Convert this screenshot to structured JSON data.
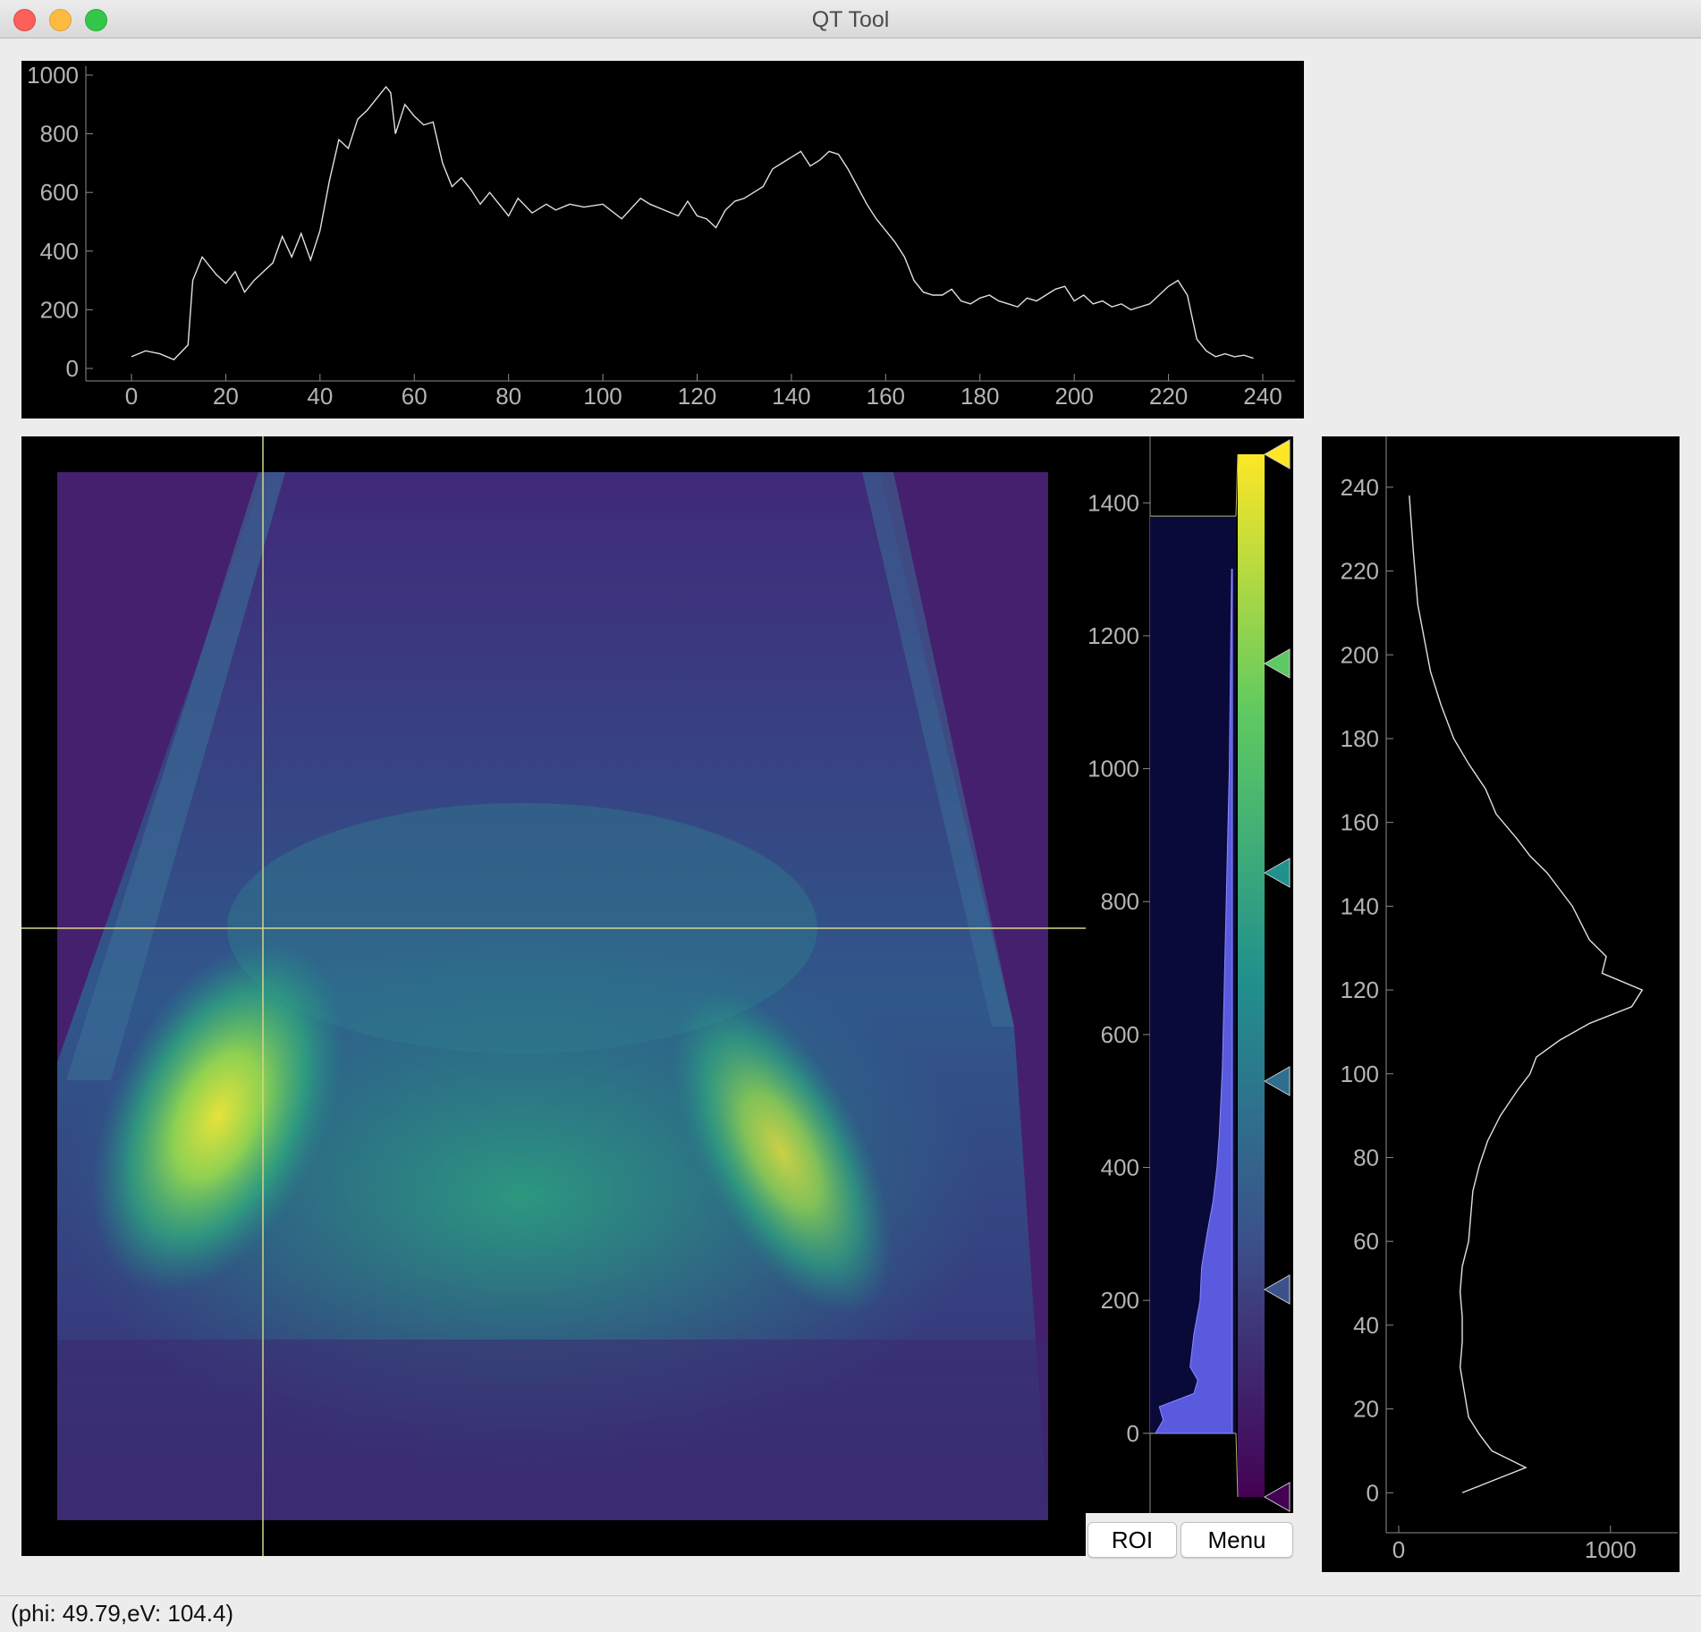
{
  "window": {
    "title": "QT Tool"
  },
  "buttons": {
    "roi": "ROI",
    "menu": "Menu"
  },
  "status": {
    "text": "(phi: 49.79,eV: 104.4)"
  },
  "colors": {
    "background": "#000000",
    "profile_line": "#e0e0e0",
    "crosshair": "#d6d68a",
    "histogram_fill": "#5a5adf",
    "histogram_bg": "#0a0a3a",
    "colormap": [
      "#440154",
      "#3b528b",
      "#21918c",
      "#5ec962",
      "#fde725"
    ]
  },
  "icons": {
    "gradient_handle": "triangle-marker-icon"
  },
  "image": {
    "colormap": "viridis",
    "crosshair": {
      "x_index": 49.79,
      "y_value": 104.4
    }
  },
  "top_plot": {
    "x_ticks": [
      "0",
      "20",
      "40",
      "60",
      "80",
      "100",
      "120",
      "140",
      "160",
      "180",
      "200",
      "220",
      "240"
    ],
    "y_ticks": [
      "0",
      "200",
      "400",
      "600",
      "800",
      "1000"
    ]
  },
  "histogram": {
    "y_ticks": [
      "0",
      "200",
      "400",
      "600",
      "800",
      "1000",
      "1200",
      "1400"
    ],
    "level_min": 0,
    "level_max": 1380
  },
  "side_plot": {
    "y_ticks": [
      "0",
      "20",
      "40",
      "60",
      "80",
      "100",
      "120",
      "140",
      "160",
      "180",
      "200",
      "220",
      "240"
    ],
    "x_ticks": [
      "0",
      "1000"
    ]
  },
  "chart_data": [
    {
      "type": "line",
      "orientation": "horizontal-profile",
      "x": [
        0,
        3,
        6,
        9,
        12,
        13,
        15,
        18,
        20,
        22,
        24,
        26,
        28,
        30,
        32,
        34,
        36,
        38,
        40,
        42,
        44,
        46,
        48,
        50,
        52,
        54,
        55,
        56,
        58,
        60,
        62,
        64,
        66,
        68,
        70,
        72,
        74,
        76,
        78,
        80,
        82,
        85,
        88,
        90,
        93,
        96,
        100,
        104,
        108,
        110,
        113,
        116,
        118,
        120,
        122,
        124,
        126,
        128,
        130,
        132,
        134,
        136,
        138,
        140,
        142,
        144,
        146,
        148,
        150,
        152,
        154,
        156,
        158,
        160,
        162,
        164,
        166,
        168,
        170,
        172,
        174,
        176,
        178,
        180,
        182,
        184,
        186,
        188,
        190,
        192,
        194,
        196,
        198,
        200,
        202,
        204,
        206,
        208,
        210,
        212,
        214,
        216,
        218,
        220,
        222,
        224,
        226,
        228,
        230,
        232,
        234,
        236,
        238
      ],
      "y": [
        40,
        60,
        50,
        30,
        80,
        300,
        380,
        320,
        290,
        330,
        260,
        300,
        330,
        360,
        450,
        380,
        460,
        370,
        470,
        640,
        780,
        750,
        850,
        880,
        920,
        960,
        940,
        800,
        900,
        860,
        830,
        840,
        700,
        620,
        650,
        610,
        560,
        600,
        560,
        520,
        580,
        530,
        560,
        540,
        560,
        550,
        560,
        510,
        580,
        560,
        540,
        520,
        570,
        520,
        510,
        480,
        540,
        570,
        580,
        600,
        620,
        680,
        700,
        720,
        740,
        690,
        710,
        740,
        730,
        680,
        620,
        560,
        510,
        470,
        430,
        380,
        300,
        260,
        250,
        250,
        270,
        230,
        220,
        240,
        250,
        230,
        220,
        210,
        240,
        230,
        250,
        270,
        280,
        230,
        250,
        220,
        230,
        210,
        220,
        200,
        210,
        220,
        250,
        280,
        300,
        250,
        100,
        60,
        40,
        50,
        40,
        45,
        35
      ],
      "xlim": [
        0,
        240
      ],
      "ylim": [
        0,
        1000
      ]
    },
    {
      "type": "line",
      "orientation": "vertical-profile",
      "x": [
        300,
        400,
        500,
        600,
        520,
        440,
        380,
        330,
        310,
        290,
        300,
        300,
        290,
        300,
        330,
        340,
        350,
        380,
        420,
        480,
        560,
        620,
        650,
        760,
        900,
        1100,
        1150,
        960,
        980,
        900,
        860,
        820,
        760,
        700,
        620,
        560,
        460,
        410,
        330,
        260,
        200,
        150,
        120,
        90,
        70,
        50
      ],
      "y": [
        0,
        2,
        4,
        6,
        8,
        10,
        14,
        18,
        24,
        30,
        36,
        42,
        48,
        54,
        60,
        66,
        72,
        78,
        84,
        90,
        96,
        100,
        104,
        108,
        112,
        116,
        120,
        124,
        128,
        132,
        136,
        140,
        144,
        148,
        152,
        156,
        162,
        168,
        174,
        180,
        188,
        196,
        204,
        212,
        224,
        238
      ],
      "xlim": [
        0,
        1250
      ],
      "ylim": [
        -4,
        250
      ]
    },
    {
      "type": "area",
      "orientation": "value-histogram",
      "bins": [
        0,
        20,
        40,
        60,
        80,
        100,
        150,
        200,
        250,
        300,
        350,
        400,
        450,
        500,
        550,
        600,
        650,
        700,
        750,
        800,
        850,
        900,
        950,
        1000,
        1050,
        1100,
        1150,
        1200,
        1250,
        1300
      ],
      "counts": [
        1.0,
        0.9,
        0.95,
        0.5,
        0.45,
        0.55,
        0.5,
        0.42,
        0.4,
        0.33,
        0.25,
        0.2,
        0.17,
        0.15,
        0.13,
        0.12,
        0.11,
        0.1,
        0.09,
        0.08,
        0.07,
        0.06,
        0.05,
        0.04,
        0.035,
        0.03,
        0.025,
        0.02,
        0.015,
        0.01
      ],
      "ylim": [
        -120,
        1500
      ]
    }
  ]
}
